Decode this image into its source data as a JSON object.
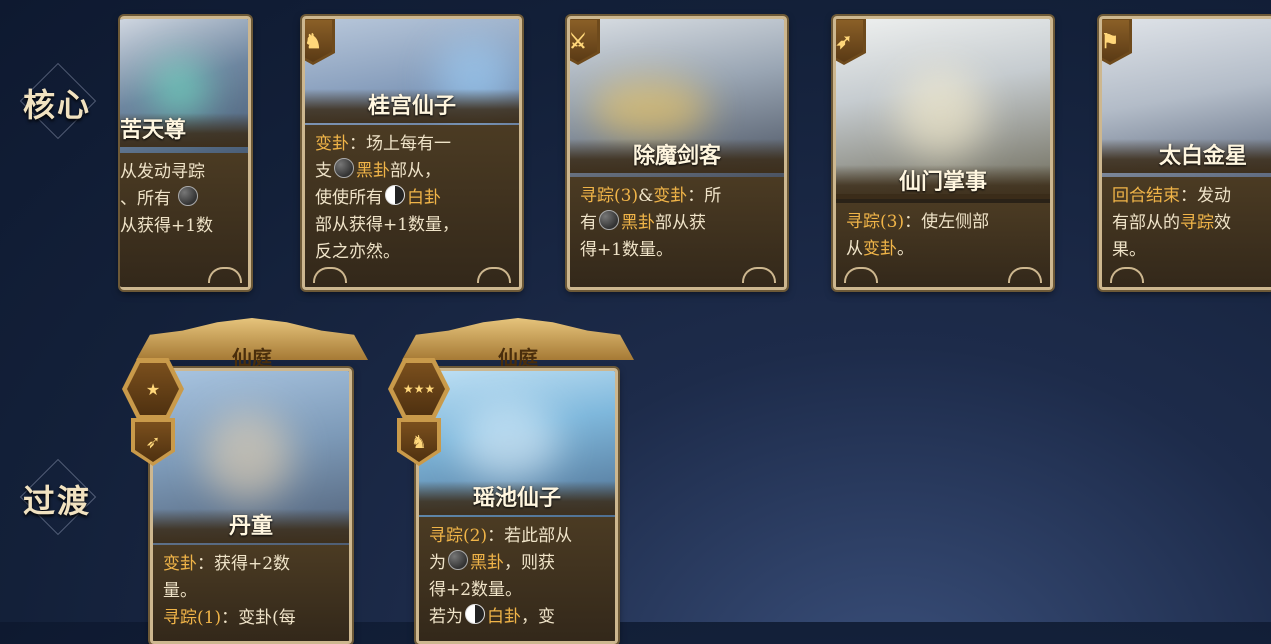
{
  "rows": {
    "core_label": "核心",
    "transition_label": "过渡"
  },
  "core_cards": [
    {
      "name": "苦天尊",
      "desc_lines": [
        "从发动寻踪",
        "、所有 ",
        "从获得+1数"
      ],
      "class_icon": "none"
    },
    {
      "name": "桂宫仙子",
      "class_icon": "horse-icon",
      "desc": {
        "l1a": "变卦",
        "l1b": "：场上每有一",
        "l2a": "支",
        "l2b": "黑卦",
        "l2c": "部从，",
        "l3a": "使使所有",
        "l3b": "白卦",
        "l4": "部从获得+1数量，",
        "l5": "反之亦然。"
      }
    },
    {
      "name": "除魔剑客",
      "class_icon": "sword-icon",
      "desc": {
        "l1a": "寻踪(3)",
        "l1b": "&",
        "l1c": "变卦",
        "l1d": "：所",
        "l2a": "有",
        "l2b": "黑卦",
        "l2c": "部从获",
        "l3": "得+1数量。"
      }
    },
    {
      "name": "仙门掌事",
      "class_icon": "bow-icon",
      "desc": {
        "l1a": "寻踪(3)",
        "l1b": "：使左侧部",
        "l2a": "从",
        "l2b": "变卦",
        "l2c": "。"
      }
    },
    {
      "name": "太白金星",
      "class_icon": "flag-icon",
      "desc": {
        "l1a": "回合结束",
        "l1b": "：发动",
        "l2a": "有部从的",
        "l2b": "寻踪",
        "l2c": "效",
        "l3": "果。"
      }
    }
  ],
  "transition_cards": [
    {
      "faction": "仙庭",
      "stars": "★",
      "class_icon": "bow-icon",
      "name": "丹童",
      "desc": {
        "l1a": "变卦",
        "l1b": "：获得+2数",
        "l2": "量。",
        "l3a": "寻踪(1)",
        "l3b": "：变卦(每"
      }
    },
    {
      "faction": "仙庭",
      "stars": "★★★",
      "class_icon": "horse-icon",
      "name": "瑶池仙子",
      "desc": {
        "l1a": "寻踪(2)",
        "l1b": "：若此部从",
        "l2a": "为",
        "l2b": "黑卦",
        "l2c": "，则获",
        "l3": "得+2数量。",
        "l4a": "若为",
        "l4b": "白卦",
        "l4c": "，变"
      }
    }
  ],
  "colors": {
    "background": "#152341",
    "keyword": "#f0b448",
    "card_border": "#cdb78f"
  }
}
